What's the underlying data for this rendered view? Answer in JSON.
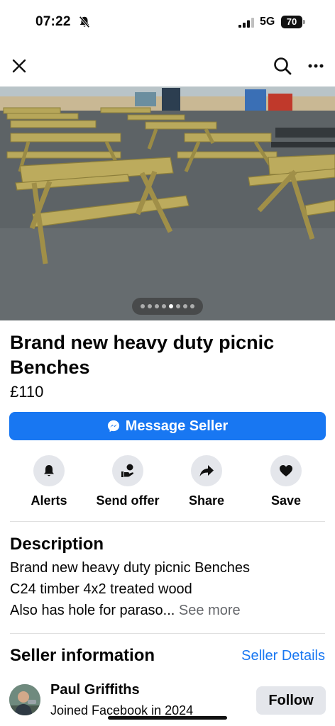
{
  "status_bar": {
    "time": "07:22",
    "network": "5G",
    "battery": "70",
    "icons": [
      "bell-slash-icon",
      "signal-icon",
      "battery-icon"
    ]
  },
  "nav": {
    "icons": [
      "close-icon",
      "search-icon",
      "more-icon"
    ]
  },
  "photo": {
    "page_count": 8,
    "active_index": 4
  },
  "listing": {
    "title": "Brand new heavy duty picnic Benches",
    "price": "£110",
    "message_button": "Message Seller"
  },
  "actions": [
    {
      "label": "Alerts",
      "icon": "bell-icon"
    },
    {
      "label": "Send offer",
      "icon": "offer-icon"
    },
    {
      "label": "Share",
      "icon": "share-icon"
    },
    {
      "label": "Save",
      "icon": "heart-icon"
    }
  ],
  "description": {
    "heading": "Description",
    "lines": [
      "Brand new heavy duty picnic Benches",
      "C24 timber 4x2 treated wood"
    ],
    "truncated_line": "Also has hole for paraso...",
    "see_more": "See more"
  },
  "seller": {
    "heading": "Seller information",
    "details_link": "Seller Details",
    "name": "Paul Griffiths",
    "joined": "Joined Facebook in 2024",
    "follow_button": "Follow"
  },
  "colors": {
    "accent": "#1877f2",
    "button_gray": "#e4e6eb",
    "secondary_text": "#65676b"
  }
}
